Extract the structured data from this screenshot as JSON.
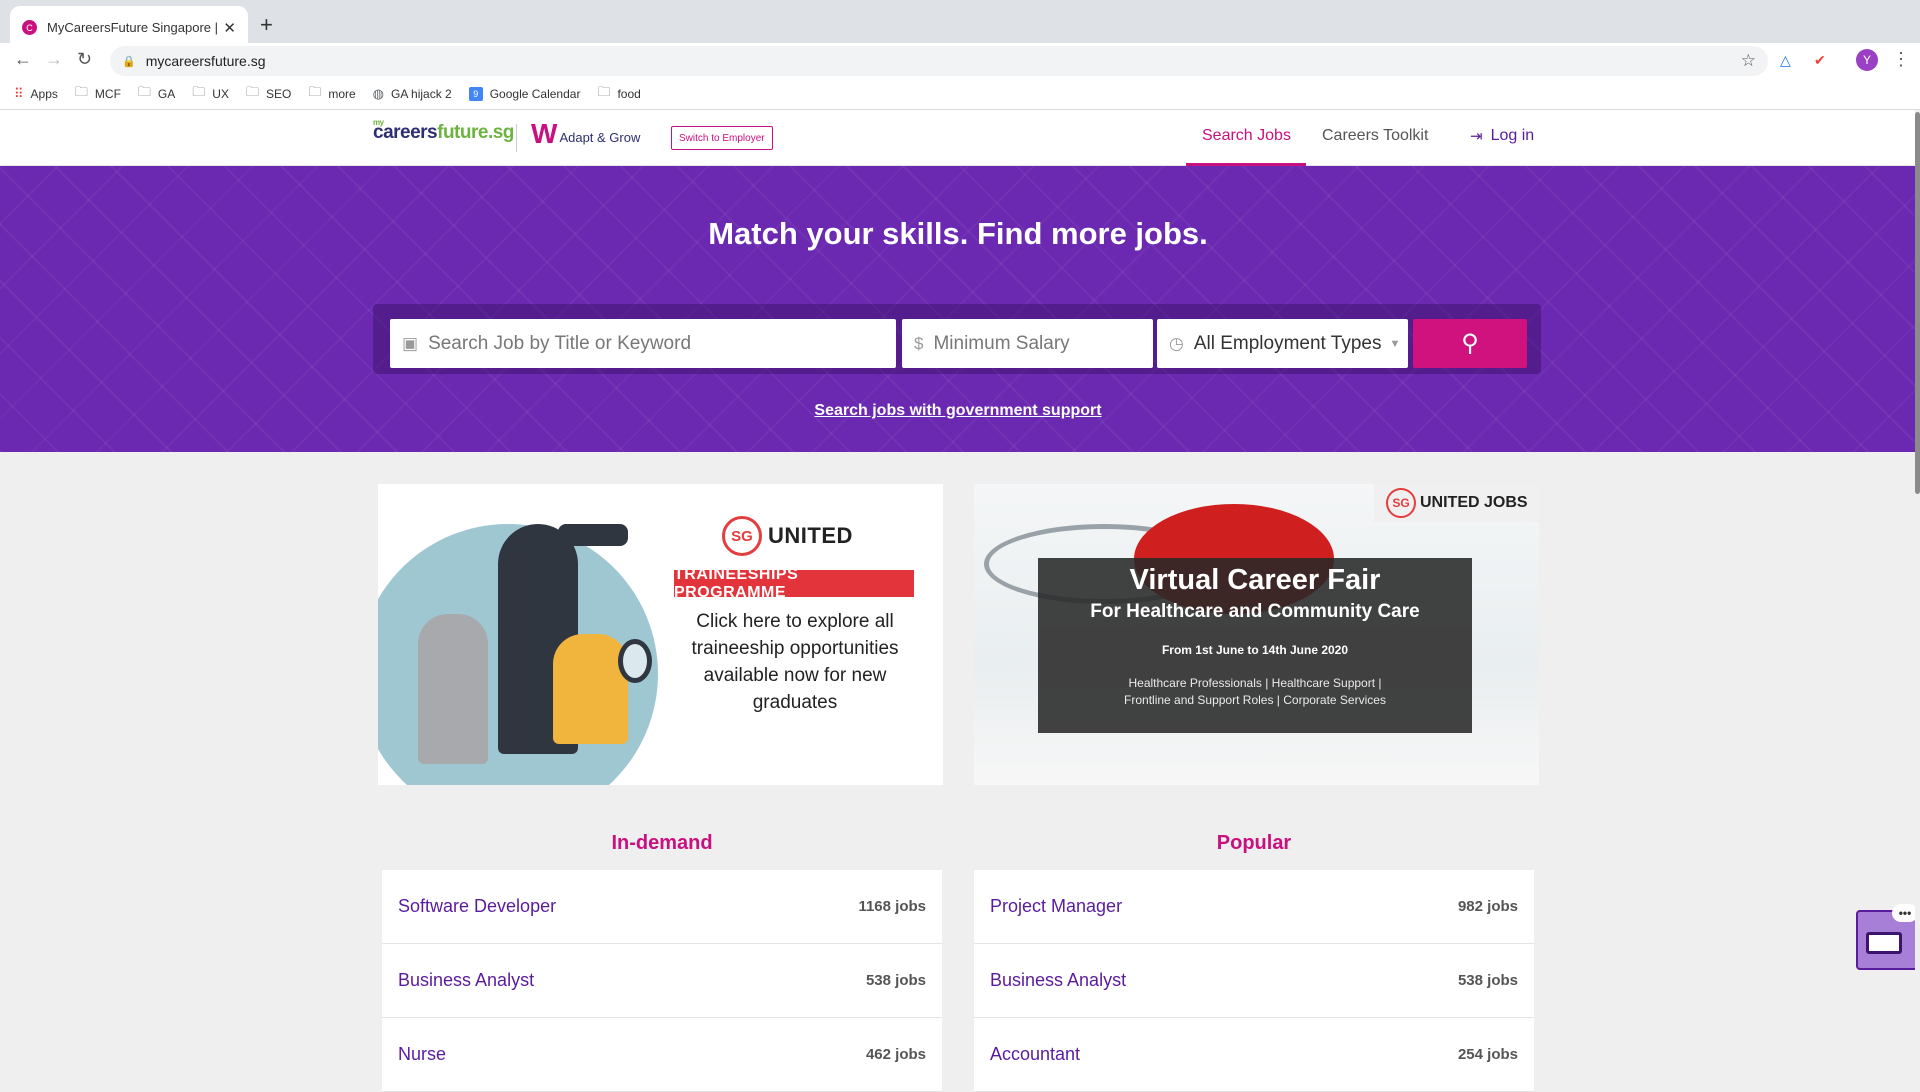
{
  "browser": {
    "tab_title": "MyCareersFuture Singapore | F",
    "favicon_letter": "C",
    "url": "mycareersfuture.sg",
    "avatar_letter": "Y",
    "bookmarks": [
      {
        "label": "Apps",
        "icon": "apps-grid-icon"
      },
      {
        "label": "MCF",
        "icon": "folder-icon"
      },
      {
        "label": "GA",
        "icon": "folder-icon"
      },
      {
        "label": "UX",
        "icon": "folder-icon"
      },
      {
        "label": "SEO",
        "icon": "folder-icon"
      },
      {
        "label": "more",
        "icon": "folder-icon"
      },
      {
        "label": "GA hijack 2",
        "icon": "globe-icon"
      },
      {
        "label": "Google Calendar",
        "icon": "calendar-icon"
      },
      {
        "label": "food",
        "icon": "folder-icon"
      }
    ]
  },
  "header": {
    "logo_small": "my",
    "logo_main": "careers",
    "logo_green": "future.sg",
    "adapt_grow": "Adapt & Grow",
    "switch_employer": "Switch to Employer",
    "nav": {
      "search_jobs": "Search Jobs",
      "careers_toolkit": "Careers Toolkit",
      "login": "Log in"
    }
  },
  "hero": {
    "title": "Match your skills. Find more jobs.",
    "keyword_placeholder": "Search Job by Title or Keyword",
    "salary_placeholder": "Minimum Salary",
    "employment_type": "All Employment Types",
    "gov_link": "Search jobs with government support"
  },
  "banners": {
    "left": {
      "sg_mark": "SG",
      "brand": "UNITED",
      "tag": "TRAINEESHIPS PROGRAMME",
      "body": "Click here to explore all traineeship opportunities available now for new graduates"
    },
    "right": {
      "sg_mark": "SG",
      "brand": "UNITED JOBS",
      "title": "Virtual Career Fair",
      "subtitle": "For Healthcare and Community Care",
      "dates": "From 1st June to 14th June 2020",
      "categories_line1": "Healthcare Professionals | Healthcare Support |",
      "categories_line2": "Frontline and Support Roles | Corporate Services"
    }
  },
  "in_demand": {
    "title": "In-demand",
    "jobs": [
      {
        "title": "Software Developer",
        "count": "1168 jobs"
      },
      {
        "title": "Business Analyst",
        "count": "538 jobs"
      },
      {
        "title": "Nurse",
        "count": "462 jobs"
      }
    ]
  },
  "popular": {
    "title": "Popular",
    "jobs": [
      {
        "title": "Project Manager",
        "count": "982 jobs"
      },
      {
        "title": "Business Analyst",
        "count": "538 jobs"
      },
      {
        "title": "Accountant",
        "count": "254 jobs"
      }
    ]
  },
  "colors": {
    "brand_purple": "#6a29b0",
    "brand_magenta": "#c8107f",
    "link_purple": "#5a1c9e"
  }
}
